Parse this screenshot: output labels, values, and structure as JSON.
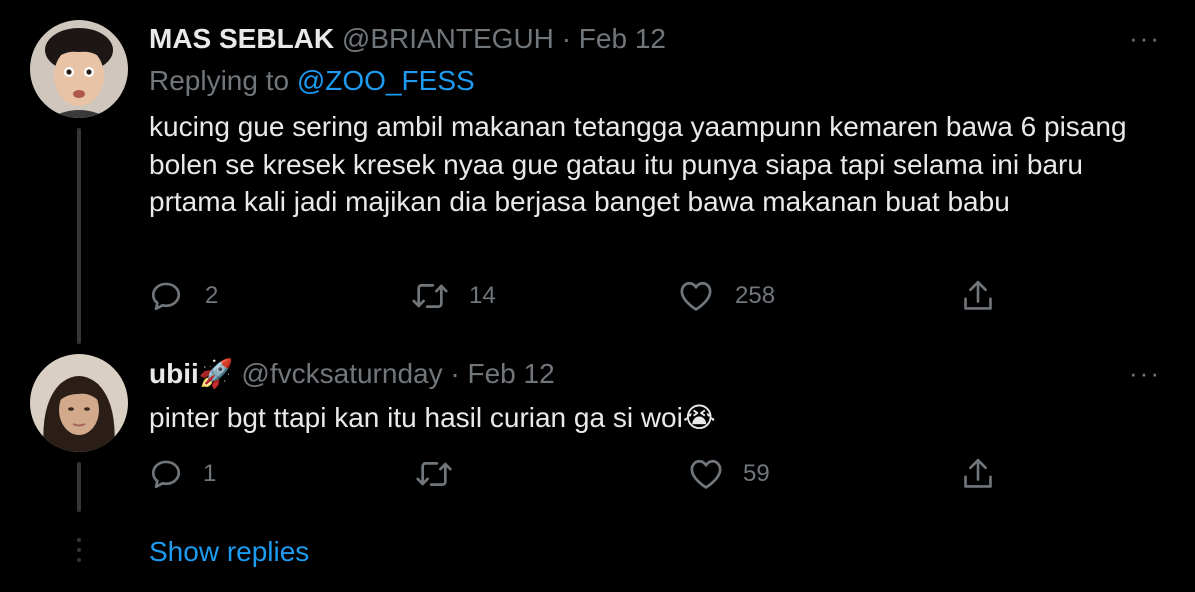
{
  "tweets": [
    {
      "name": "MAS SEBLAK",
      "handle": "@BRIANTEGUH",
      "separator": "·",
      "date": "Feb 12",
      "replying_label": "Replying to",
      "replying_to": "@ZOO_FESS",
      "text": "kucing gue sering ambil makanan tetangga yaampunn kemaren bawa 6 pisang bolen se kresek kresek nyaa gue gatau itu punya siapa tapi selama ini baru prtama kali jadi majikan dia berjasa banget bawa makanan buat babu",
      "more": "···",
      "replies": "2",
      "retweets": "14",
      "likes": "258"
    },
    {
      "name": "ubii🚀",
      "handle": "@fvcksaturnday",
      "separator": "·",
      "date": "Feb 12",
      "text": "pinter bgt ttapi kan itu hasil curian ga si woi😭",
      "more": "···",
      "replies": "1",
      "retweets": "",
      "likes": "59"
    }
  ],
  "show_replies": "Show replies",
  "colors": {
    "background": "#000000",
    "text": "#e7e9ea",
    "secondary": "#71767b",
    "accent": "#1d9bf0",
    "thread_line": "#333639"
  },
  "icons": [
    "reply-icon",
    "retweet-icon",
    "like-icon",
    "share-icon",
    "more-icon"
  ]
}
